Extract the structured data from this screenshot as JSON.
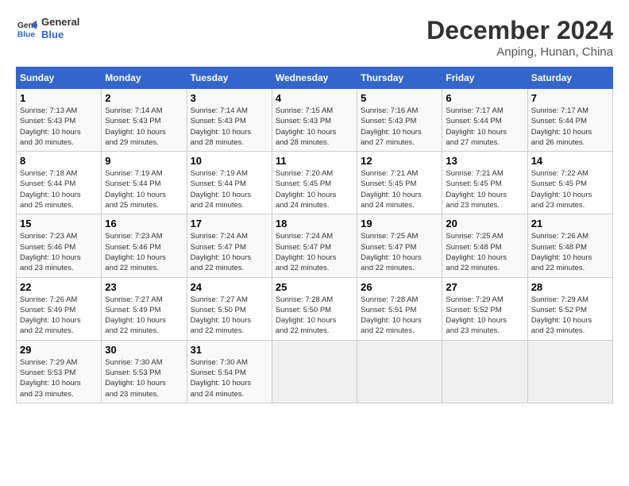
{
  "header": {
    "logo_line1": "General",
    "logo_line2": "Blue",
    "month": "December 2024",
    "location": "Anping, Hunan, China"
  },
  "weekdays": [
    "Sunday",
    "Monday",
    "Tuesday",
    "Wednesday",
    "Thursday",
    "Friday",
    "Saturday"
  ],
  "weeks": [
    [
      {
        "day": "1",
        "lines": [
          "Sunrise: 7:13 AM",
          "Sunset: 5:43 PM",
          "Daylight: 10 hours",
          "and 30 minutes."
        ]
      },
      {
        "day": "2",
        "lines": [
          "Sunrise: 7:14 AM",
          "Sunset: 5:43 PM",
          "Daylight: 10 hours",
          "and 29 minutes."
        ]
      },
      {
        "day": "3",
        "lines": [
          "Sunrise: 7:14 AM",
          "Sunset: 5:43 PM",
          "Daylight: 10 hours",
          "and 28 minutes."
        ]
      },
      {
        "day": "4",
        "lines": [
          "Sunrise: 7:15 AM",
          "Sunset: 5:43 PM",
          "Daylight: 10 hours",
          "and 28 minutes."
        ]
      },
      {
        "day": "5",
        "lines": [
          "Sunrise: 7:16 AM",
          "Sunset: 5:43 PM",
          "Daylight: 10 hours",
          "and 27 minutes."
        ]
      },
      {
        "day": "6",
        "lines": [
          "Sunrise: 7:17 AM",
          "Sunset: 5:44 PM",
          "Daylight: 10 hours",
          "and 27 minutes."
        ]
      },
      {
        "day": "7",
        "lines": [
          "Sunrise: 7:17 AM",
          "Sunset: 5:44 PM",
          "Daylight: 10 hours",
          "and 26 minutes."
        ]
      }
    ],
    [
      {
        "day": "8",
        "lines": [
          "Sunrise: 7:18 AM",
          "Sunset: 5:44 PM",
          "Daylight: 10 hours",
          "and 25 minutes."
        ]
      },
      {
        "day": "9",
        "lines": [
          "Sunrise: 7:19 AM",
          "Sunset: 5:44 PM",
          "Daylight: 10 hours",
          "and 25 minutes."
        ]
      },
      {
        "day": "10",
        "lines": [
          "Sunrise: 7:19 AM",
          "Sunset: 5:44 PM",
          "Daylight: 10 hours",
          "and 24 minutes."
        ]
      },
      {
        "day": "11",
        "lines": [
          "Sunrise: 7:20 AM",
          "Sunset: 5:45 PM",
          "Daylight: 10 hours",
          "and 24 minutes."
        ]
      },
      {
        "day": "12",
        "lines": [
          "Sunrise: 7:21 AM",
          "Sunset: 5:45 PM",
          "Daylight: 10 hours",
          "and 24 minutes."
        ]
      },
      {
        "day": "13",
        "lines": [
          "Sunrise: 7:21 AM",
          "Sunset: 5:45 PM",
          "Daylight: 10 hours",
          "and 23 minutes."
        ]
      },
      {
        "day": "14",
        "lines": [
          "Sunrise: 7:22 AM",
          "Sunset: 5:45 PM",
          "Daylight: 10 hours",
          "and 23 minutes."
        ]
      }
    ],
    [
      {
        "day": "15",
        "lines": [
          "Sunrise: 7:23 AM",
          "Sunset: 5:46 PM",
          "Daylight: 10 hours",
          "and 23 minutes."
        ]
      },
      {
        "day": "16",
        "lines": [
          "Sunrise: 7:23 AM",
          "Sunset: 5:46 PM",
          "Daylight: 10 hours",
          "and 22 minutes."
        ]
      },
      {
        "day": "17",
        "lines": [
          "Sunrise: 7:24 AM",
          "Sunset: 5:47 PM",
          "Daylight: 10 hours",
          "and 22 minutes."
        ]
      },
      {
        "day": "18",
        "lines": [
          "Sunrise: 7:24 AM",
          "Sunset: 5:47 PM",
          "Daylight: 10 hours",
          "and 22 minutes."
        ]
      },
      {
        "day": "19",
        "lines": [
          "Sunrise: 7:25 AM",
          "Sunset: 5:47 PM",
          "Daylight: 10 hours",
          "and 22 minutes."
        ]
      },
      {
        "day": "20",
        "lines": [
          "Sunrise: 7:25 AM",
          "Sunset: 5:48 PM",
          "Daylight: 10 hours",
          "and 22 minutes."
        ]
      },
      {
        "day": "21",
        "lines": [
          "Sunrise: 7:26 AM",
          "Sunset: 5:48 PM",
          "Daylight: 10 hours",
          "and 22 minutes."
        ]
      }
    ],
    [
      {
        "day": "22",
        "lines": [
          "Sunrise: 7:26 AM",
          "Sunset: 5:49 PM",
          "Daylight: 10 hours",
          "and 22 minutes."
        ]
      },
      {
        "day": "23",
        "lines": [
          "Sunrise: 7:27 AM",
          "Sunset: 5:49 PM",
          "Daylight: 10 hours",
          "and 22 minutes."
        ]
      },
      {
        "day": "24",
        "lines": [
          "Sunrise: 7:27 AM",
          "Sunset: 5:50 PM",
          "Daylight: 10 hours",
          "and 22 minutes."
        ]
      },
      {
        "day": "25",
        "lines": [
          "Sunrise: 7:28 AM",
          "Sunset: 5:50 PM",
          "Daylight: 10 hours",
          "and 22 minutes."
        ]
      },
      {
        "day": "26",
        "lines": [
          "Sunrise: 7:28 AM",
          "Sunset: 5:51 PM",
          "Daylight: 10 hours",
          "and 22 minutes."
        ]
      },
      {
        "day": "27",
        "lines": [
          "Sunrise: 7:29 AM",
          "Sunset: 5:52 PM",
          "Daylight: 10 hours",
          "and 23 minutes."
        ]
      },
      {
        "day": "28",
        "lines": [
          "Sunrise: 7:29 AM",
          "Sunset: 5:52 PM",
          "Daylight: 10 hours",
          "and 23 minutes."
        ]
      }
    ],
    [
      {
        "day": "29",
        "lines": [
          "Sunrise: 7:29 AM",
          "Sunset: 5:53 PM",
          "Daylight: 10 hours",
          "and 23 minutes."
        ]
      },
      {
        "day": "30",
        "lines": [
          "Sunrise: 7:30 AM",
          "Sunset: 5:53 PM",
          "Daylight: 10 hours",
          "and 23 minutes."
        ]
      },
      {
        "day": "31",
        "lines": [
          "Sunrise: 7:30 AM",
          "Sunset: 5:54 PM",
          "Daylight: 10 hours",
          "and 24 minutes."
        ]
      },
      {
        "day": "",
        "lines": []
      },
      {
        "day": "",
        "lines": []
      },
      {
        "day": "",
        "lines": []
      },
      {
        "day": "",
        "lines": []
      }
    ]
  ]
}
